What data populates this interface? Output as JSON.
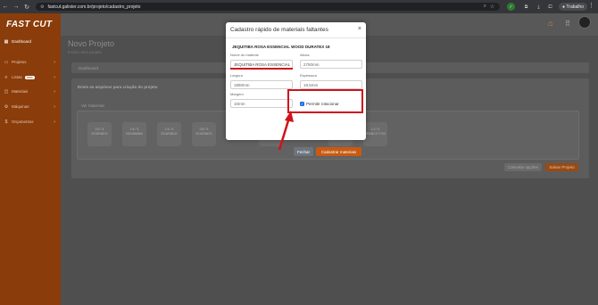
{
  "browser": {
    "url": "fastcut.galister.com.br/projeto/cadastro_projeto",
    "profile_label": "Trabalho",
    "icons": [
      "back-arrow-icon",
      "forward-arrow-icon",
      "reload-icon",
      "site-info-icon",
      "zoom-icon",
      "star-icon",
      "extension-icon",
      "download-icon",
      "puzzle-icon",
      "profile-icon",
      "kebab-menu-icon"
    ]
  },
  "app": {
    "brand": "FAST CUT",
    "sidebar": [
      {
        "label": "Dashboard",
        "icon": "dashboard-icon"
      },
      {
        "label": "Projetos",
        "icon": "folder-icon"
      },
      {
        "label": "Listas",
        "badge": "beta",
        "icon": "list-icon"
      },
      {
        "label": "Materiais",
        "icon": "box-icon"
      },
      {
        "label": "Máquinas",
        "icon": "machine-icon"
      },
      {
        "label": "Orçamentos",
        "icon": "budget-icon"
      }
    ],
    "topbar_icons": [
      "home-icon",
      "apps-grid-icon",
      "avatar"
    ]
  },
  "page": {
    "title": "Novo Projeto",
    "subtitle": "Iniciar novo projeto",
    "tab_dashboard": "Dashboard",
    "section_title": "Envie os arquivos para criação do projeto",
    "ver_materiais": "Ver Materiais",
    "tiles": [
      {
        "l1": "0.9 / 3",
        "l2": "DOURADO"
      },
      {
        "l1": "1.5 / 3",
        "l2": "NOVAMINA"
      },
      {
        "l1": "1.5 / 3",
        "l2": "DOURADO"
      },
      {
        "l1": "0.8 / 3",
        "l2": "DOURADO"
      },
      {
        "l1": "1.2 / 3",
        "l2": "BRANCO TX/C"
      }
    ],
    "cancel_btn": "Cancelar opções",
    "save_btn": "Salvar Projeto"
  },
  "modal": {
    "title": "Cadastro rápido de materiais faltantes",
    "close_icon": "close-icon",
    "material_header": "JEQUITIBA ROSA ESSENCIAL WOOD DURATEX 18",
    "fields": {
      "nome": {
        "label": "Nome do material",
        "value": "JEQUITIBA ROSA ESSENCIAL"
      },
      "altura": {
        "label": "Altura",
        "value": "2750mm"
      },
      "largura": {
        "label": "Largura",
        "value": "1850mm"
      },
      "espessura": {
        "label": "Espessura",
        "value": "18,5mm"
      },
      "margem": {
        "label": "Margem",
        "value": "10mm"
      }
    },
    "checkbox": {
      "label": "Permite rotacionar",
      "checked": true
    },
    "btn_close": "Fechar",
    "btn_submit": "Cadastrar materiais"
  },
  "annotation": {
    "color": "#d0131b"
  }
}
